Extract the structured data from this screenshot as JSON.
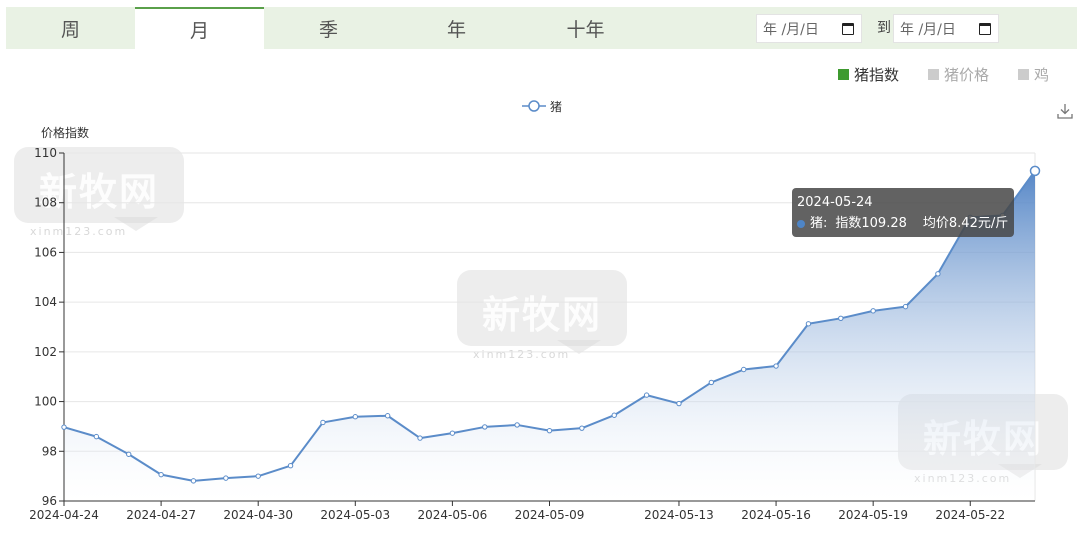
{
  "tabs": [
    {
      "label": "周",
      "active": false
    },
    {
      "label": "月",
      "active": true
    },
    {
      "label": "季",
      "active": false
    },
    {
      "label": "年",
      "active": false
    },
    {
      "label": "十年",
      "active": false
    }
  ],
  "date_range": {
    "start_placeholder": "年 /月/日",
    "end_placeholder": "年 /月/日",
    "to_label": "到"
  },
  "filters": [
    {
      "label": "猪指数",
      "active": true
    },
    {
      "label": "猪价格",
      "active": false
    },
    {
      "label": "鸡",
      "active": false
    }
  ],
  "watermark": {
    "text": "新牧网",
    "sub": "xinm123.com"
  },
  "tooltip": {
    "date": "2024-05-24",
    "series": "猪:",
    "index_label": "指数109.28",
    "price_label": "均价8.42元/斤"
  },
  "colors": {
    "line": "#5b8cc9",
    "area_top": "#4e81c4",
    "area_bottom": "#ffffff",
    "active_filter": "#3e9a2f",
    "tab_bar": "#e9f2e4"
  },
  "chart_data": {
    "type": "area",
    "legend": [
      "猪"
    ],
    "ylabel": "价格指数",
    "ylim": [
      96,
      110
    ],
    "yticks": [
      96,
      98,
      100,
      102,
      104,
      106,
      108,
      110
    ],
    "x": [
      "2024-04-24",
      "2024-04-25",
      "2024-04-26",
      "2024-04-27",
      "2024-04-28",
      "2024-04-29",
      "2024-04-30",
      "2024-05-01",
      "2024-05-02",
      "2024-05-03",
      "2024-05-04",
      "2024-05-05",
      "2024-05-06",
      "2024-05-07",
      "2024-05-08",
      "2024-05-09",
      "2024-05-10",
      "2024-05-11",
      "2024-05-12",
      "2024-05-13",
      "2024-05-14",
      "2024-05-15",
      "2024-05-16",
      "2024-05-17",
      "2024-05-18",
      "2024-05-19",
      "2024-05-20",
      "2024-05-21",
      "2024-05-22",
      "2024-05-23",
      "2024-05-24"
    ],
    "xtick_labels": [
      "2024-04-24",
      "2024-04-27",
      "2024-04-30",
      "2024-05-03",
      "2024-05-06",
      "2024-05-09",
      "2024-05-13",
      "2024-05-16",
      "2024-05-19",
      "2024-05-22"
    ],
    "series": [
      {
        "name": "猪",
        "values": [
          98.97,
          98.59,
          97.88,
          97.06,
          96.81,
          96.92,
          97.0,
          97.42,
          99.16,
          99.39,
          99.43,
          98.53,
          98.73,
          98.98,
          99.06,
          98.83,
          98.93,
          99.45,
          100.26,
          99.92,
          100.77,
          101.29,
          101.43,
          103.13,
          103.35,
          103.65,
          103.82,
          105.14,
          107.41,
          107.49,
          109.28
        ]
      }
    ]
  }
}
